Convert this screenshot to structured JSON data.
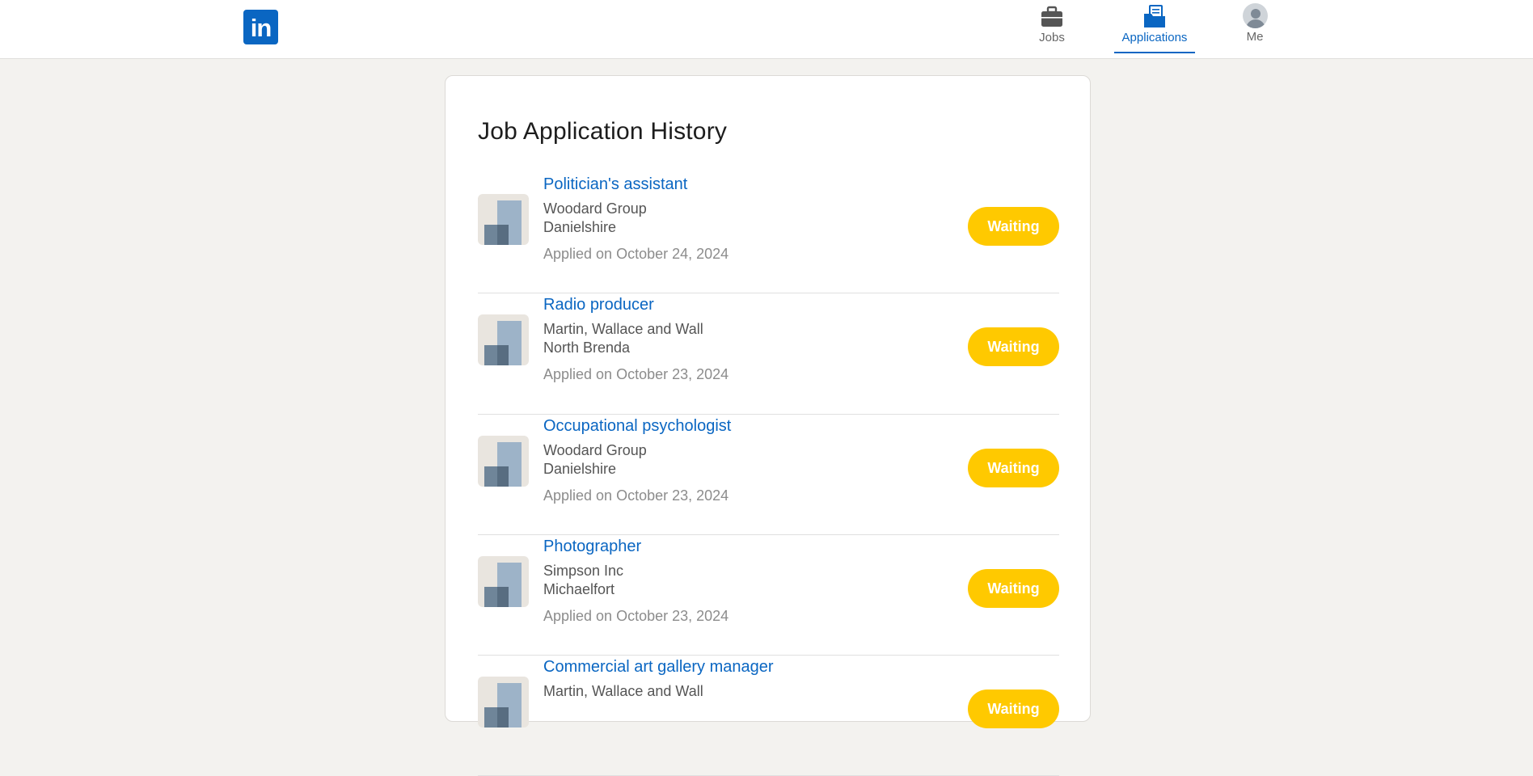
{
  "nav": {
    "logo_text": "in",
    "jobs_label": "Jobs",
    "applications_label": "Applications",
    "me_label": "Me"
  },
  "colors": {
    "brand": "#0a66c2",
    "status_waiting": "#ffc900",
    "background": "#f3f2ef"
  },
  "page": {
    "title": "Job Application History"
  },
  "applications": [
    {
      "title": "Politician's assistant",
      "company": "Woodard Group",
      "location": "Danielshire",
      "applied": "Applied on October 24, 2024",
      "status": "Waiting"
    },
    {
      "title": "Radio producer",
      "company": "Martin, Wallace and Wall",
      "location": "North Brenda",
      "applied": "Applied on October 23, 2024",
      "status": "Waiting"
    },
    {
      "title": "Occupational psychologist",
      "company": "Woodard Group",
      "location": "Danielshire",
      "applied": "Applied on October 23, 2024",
      "status": "Waiting"
    },
    {
      "title": "Photographer",
      "company": "Simpson Inc",
      "location": "Michaelfort",
      "applied": "Applied on October 23, 2024",
      "status": "Waiting"
    },
    {
      "title": "Commercial art gallery manager",
      "company": "Martin, Wallace and Wall",
      "location": "",
      "applied": "",
      "status": "Waiting"
    }
  ]
}
